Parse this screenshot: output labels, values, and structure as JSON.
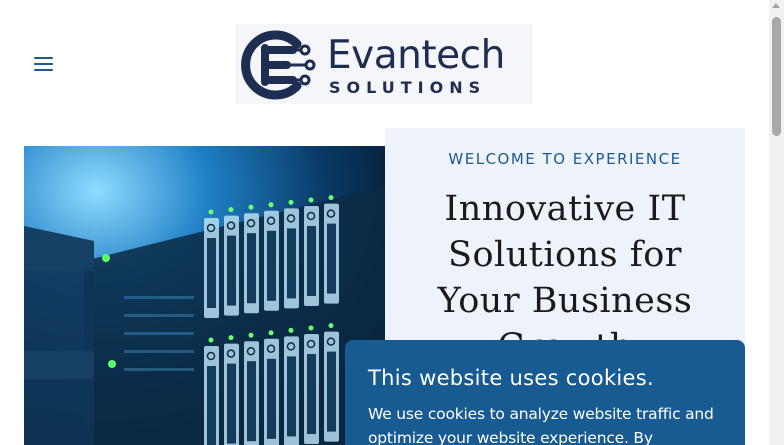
{
  "header": {
    "menu_icon": "hamburger-menu-icon",
    "logo": {
      "name": "Evantech",
      "tagline": "SOLUTIONS",
      "brand_color": "#1e2e52"
    }
  },
  "hero": {
    "image_subject": "server-rack",
    "eyebrow": "WELCOME TO EXPERIENCE",
    "title_lines": [
      "Innovative IT",
      "Solutions for",
      "Your Business",
      "Growth"
    ],
    "panel_color": "#eef2fb",
    "accent_color": "#1d5a8e"
  },
  "cookie_banner": {
    "title": "This website uses cookies.",
    "text_lines": [
      "We use cookies to analyze website traffic and",
      "optimize your website experience. By"
    ],
    "background_color": "#175b92"
  }
}
